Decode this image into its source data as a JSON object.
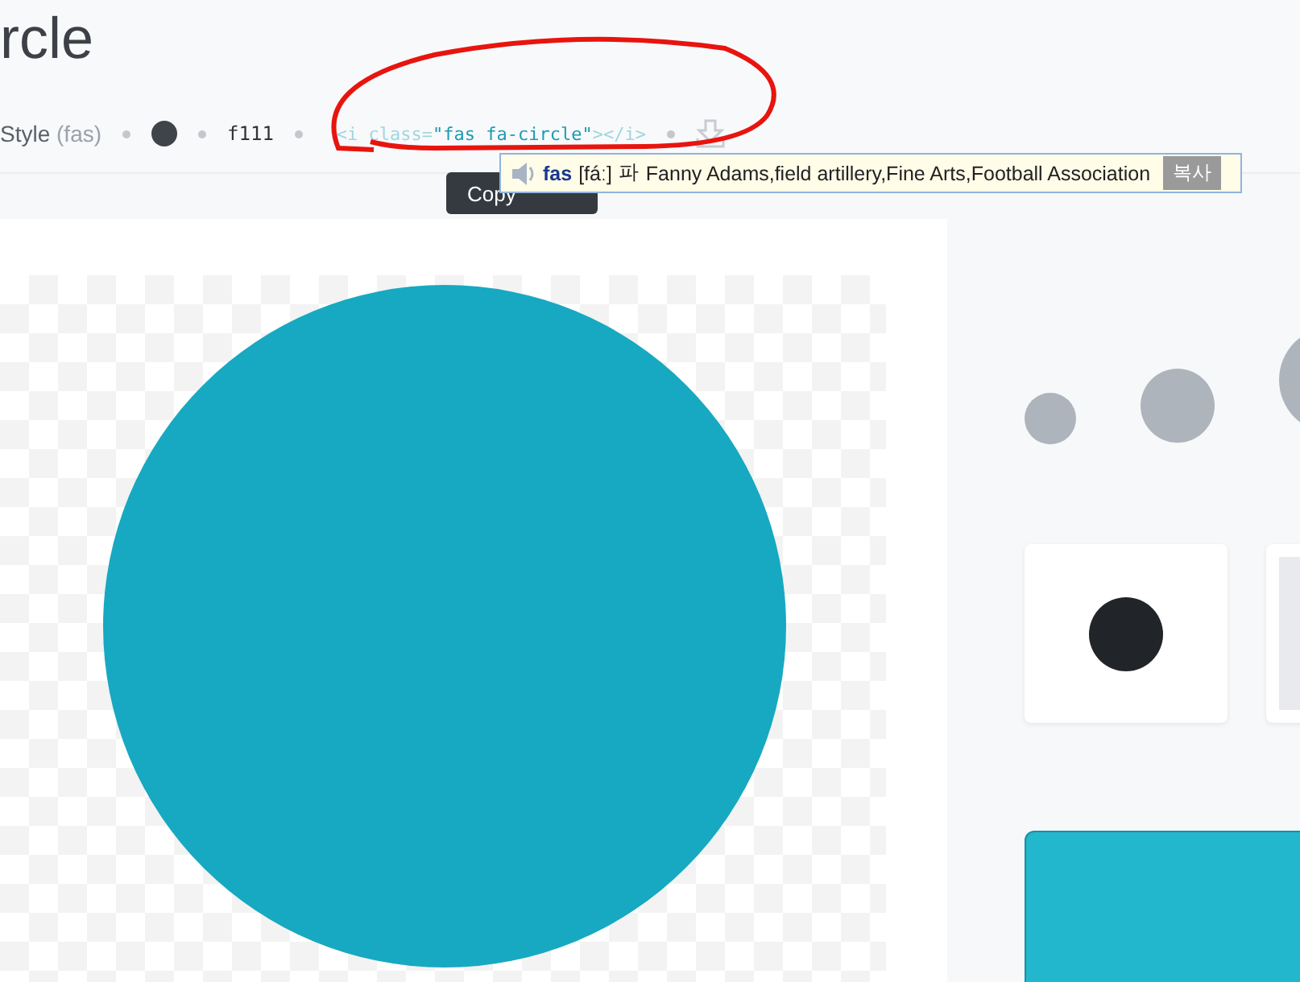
{
  "title": "rcle",
  "meta": {
    "style_label": "Style",
    "style_prefix": "(fas)",
    "unicode": "f111",
    "code": {
      "open": "<i class=",
      "value": "\"fas fa-circle\"",
      "close": "></i>"
    }
  },
  "tooltip": {
    "text": "Copy"
  },
  "dictionary_popup": {
    "word": "fas",
    "pronunciation": "[fáː]",
    "reading": "파",
    "definition": "Fanny Adams,field artillery,Fine Arts,Football Association",
    "button": "복사"
  }
}
